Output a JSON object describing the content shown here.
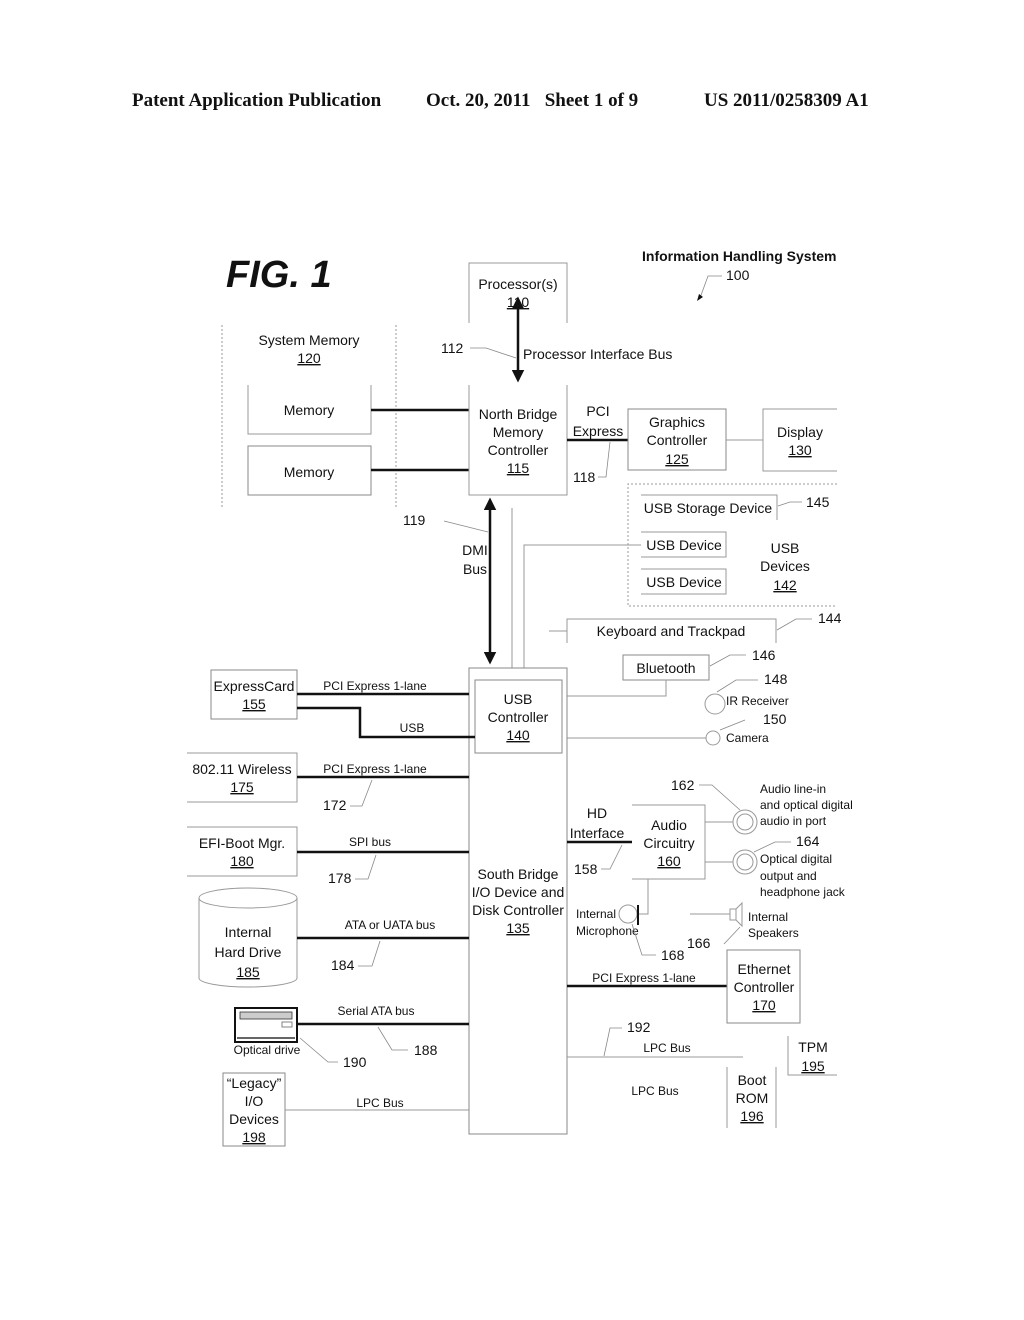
{
  "header": {
    "publication": "Patent Application Publication",
    "date_sheet": "Oct. 20, 2011   Sheet 1 of 9",
    "number": "US 2011/0258309 A1"
  },
  "figure": {
    "label": "FIG. 1",
    "system_title": "Information Handling System",
    "system_ref": "100"
  },
  "blocks": {
    "processor": {
      "name": "Processor(s)",
      "ref": "110"
    },
    "system_memory": {
      "name": "System Memory",
      "ref": "120"
    },
    "memory1": {
      "name": "Memory"
    },
    "memory2": {
      "name": "Memory"
    },
    "north_bridge": {
      "line1": "North Bridge",
      "line2": "Memory",
      "line3": "Controller",
      "ref": "115"
    },
    "graphics": {
      "line1": "Graphics",
      "line2": "Controller",
      "ref": "125"
    },
    "display": {
      "name": "Display",
      "ref": "130"
    },
    "usb_storage": {
      "name": "USB Storage Device",
      "ref": "145"
    },
    "usb_device1": {
      "name": "USB Device"
    },
    "usb_device2": {
      "name": "USB Device"
    },
    "usb_devices": {
      "line1": "USB",
      "line2": "Devices",
      "ref": "142"
    },
    "keyboard": {
      "name": "Keyboard and Trackpad",
      "ref": "144"
    },
    "bluetooth": {
      "name": "Bluetooth",
      "ref": "146"
    },
    "ir_receiver": {
      "name": "IR Receiver",
      "ref": "148"
    },
    "camera": {
      "name": "Camera",
      "ref": "150"
    },
    "usb_controller": {
      "line1": "USB",
      "line2": "Controller",
      "ref": "140"
    },
    "south_bridge": {
      "line1": "South Bridge",
      "line2": "I/O Device and",
      "line3": "Disk Controller",
      "ref": "135"
    },
    "expresscard": {
      "name": "ExpressCard",
      "ref": "155"
    },
    "wireless": {
      "name": "802.11 Wireless",
      "ref": "175"
    },
    "efi": {
      "name": "EFI-Boot Mgr.",
      "ref": "180"
    },
    "hard_drive": {
      "line1": "Internal",
      "line2": "Hard Drive",
      "ref": "185"
    },
    "optical": {
      "name": "Optical drive",
      "ref": "190"
    },
    "legacy": {
      "line1": "“Legacy”",
      "line2": "I/O",
      "line3": "Devices",
      "ref": "198"
    },
    "audio": {
      "line1": "Audio",
      "line2": "Circuitry",
      "ref": "160"
    },
    "audio_in": {
      "line1": "Audio line-in",
      "line2": "and optical digital",
      "line3": "audio in port",
      "ref": "162"
    },
    "audio_out": {
      "line1": "Optical digital",
      "line2": "output and",
      "line3": "headphone jack",
      "ref": "164"
    },
    "speakers": {
      "line1": "Internal",
      "line2": "Speakers",
      "ref": "166"
    },
    "microphone": {
      "line1": "Internal",
      "line2": "Microphone",
      "ref": "168"
    },
    "ethernet": {
      "line1": "Ethernet",
      "line2": "Controller",
      "ref": "170"
    },
    "tpm": {
      "name": "TPM",
      "ref": "195"
    },
    "boot_rom": {
      "line1": "Boot",
      "line2": "ROM",
      "ref": "196"
    }
  },
  "buses": {
    "processor_bus": {
      "name": "Processor Interface Bus",
      "ref": "112"
    },
    "pci_express": {
      "line1": "PCI",
      "line2": "Express",
      "ref": "118"
    },
    "dmi": {
      "line1": "DMI",
      "line2": "Bus",
      "ref": "119"
    },
    "expresscard_pcie": "PCI Express 1-lane",
    "expresscard_usb": "USB",
    "wireless_pcie": {
      "name": "PCI Express 1-lane",
      "ref": "172"
    },
    "spi": {
      "name": "SPI bus",
      "ref": "178"
    },
    "ata": {
      "name": "ATA or UATA bus",
      "ref": "184"
    },
    "sata": {
      "name": "Serial ATA bus",
      "ref": "188"
    },
    "legacy_lpc": "LPC Bus",
    "hd_interface": {
      "line1": "HD",
      "line2": "Interface",
      "ref": "158"
    },
    "ethernet_pcie": "PCI Express 1-lane",
    "lpc_upper": {
      "name": "LPC Bus",
      "ref": "192"
    },
    "lpc_lower": "LPC Bus"
  }
}
